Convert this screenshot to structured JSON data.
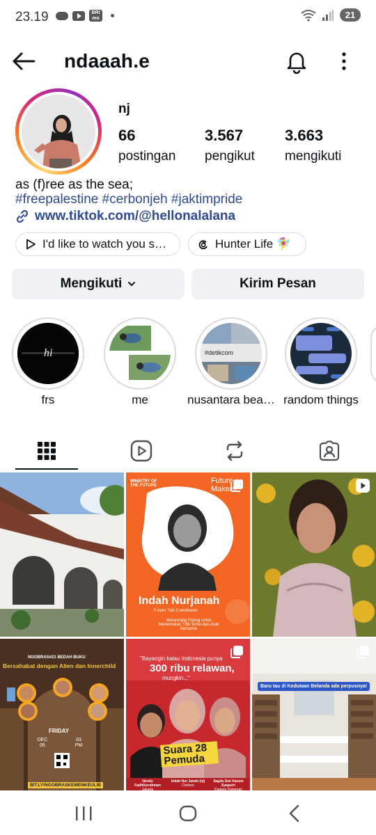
{
  "status_bar": {
    "time": "23.19",
    "bri_label": "BRI mo",
    "battery": "21"
  },
  "header": {
    "username": "ndaaah.e"
  },
  "profile": {
    "display_name": "nj",
    "stats": [
      {
        "value": "66",
        "label": "postingan"
      },
      {
        "value": "3.567",
        "label": "pengikut"
      },
      {
        "value": "3.663",
        "label": "mengikuti"
      }
    ],
    "bio": "as (f)ree as the sea;",
    "hashtags": "#freepalestine #cerbonjeh #jaktimpride",
    "link": "www.tiktok.com/@hellonalalana"
  },
  "chips": [
    {
      "label": "I'd like to watch you s…",
      "icon": "play-outline-icon"
    },
    {
      "label": "Hunter Life 🧚‍♀️",
      "icon": "threads-icon"
    }
  ],
  "actions": {
    "following_label": "Mengikuti",
    "message_label": "Kirim Pesan"
  },
  "highlights": [
    {
      "label": "frs",
      "caption": "hi"
    },
    {
      "label": "me"
    },
    {
      "label": "nusantara bea…",
      "caption": "#detikcom"
    },
    {
      "label": "random things"
    }
  ],
  "tabs": [
    "grid-icon",
    "reels-icon",
    "tagged-repost-icon",
    "tagged-person-icon"
  ],
  "posts": [
    {
      "kind": "photo",
      "subject": "white-arched-building"
    },
    {
      "kind": "carousel",
      "brand": "MINISTRY OF THE FUTURE",
      "corner": "Future Makers",
      "name": "Indah Nurjanah",
      "role": "Future Talk Coordinator",
      "subtitle": "Merancang Dialog untuk Menemukan Titik Temu dan Arah Bersama"
    },
    {
      "kind": "reel",
      "subject": "girl-in-sunflower-field"
    },
    {
      "kind": "photo",
      "series": "NGOBRAS#21 BEDAH BUKU",
      "title": "Bersahabat dengan Alien dan Innerchild",
      "day": "FRIDAY",
      "date": "DEC 05",
      "time": "03 PM",
      "link": "BIT.LY/NGOBRASKEMENKEULIB"
    },
    {
      "kind": "carousel",
      "quote": "\"Bayangin kalau Indonesia punya",
      "quote_big": "300 ribu relawan,",
      "quote_end": "mungkin...\"",
      "brand": "Suara 28 Pemuda",
      "people": [
        {
          "name": "Nendy Fadhilurrahman",
          "city": "Jakarta"
        },
        {
          "name": "Indah Nur Janah (nj)",
          "city": "Cirebon"
        },
        {
          "name": "Sagita Dwi Hanum Syaputri",
          "city": "Padang Pariaman"
        }
      ]
    },
    {
      "kind": "carousel",
      "caption": "Baru tau di Kedutaan Belanda ada perpusnya!"
    }
  ],
  "colors": {
    "link": "#2f4a8f",
    "button_bg": "#eff1f4",
    "accent_orange": "#f26522"
  }
}
